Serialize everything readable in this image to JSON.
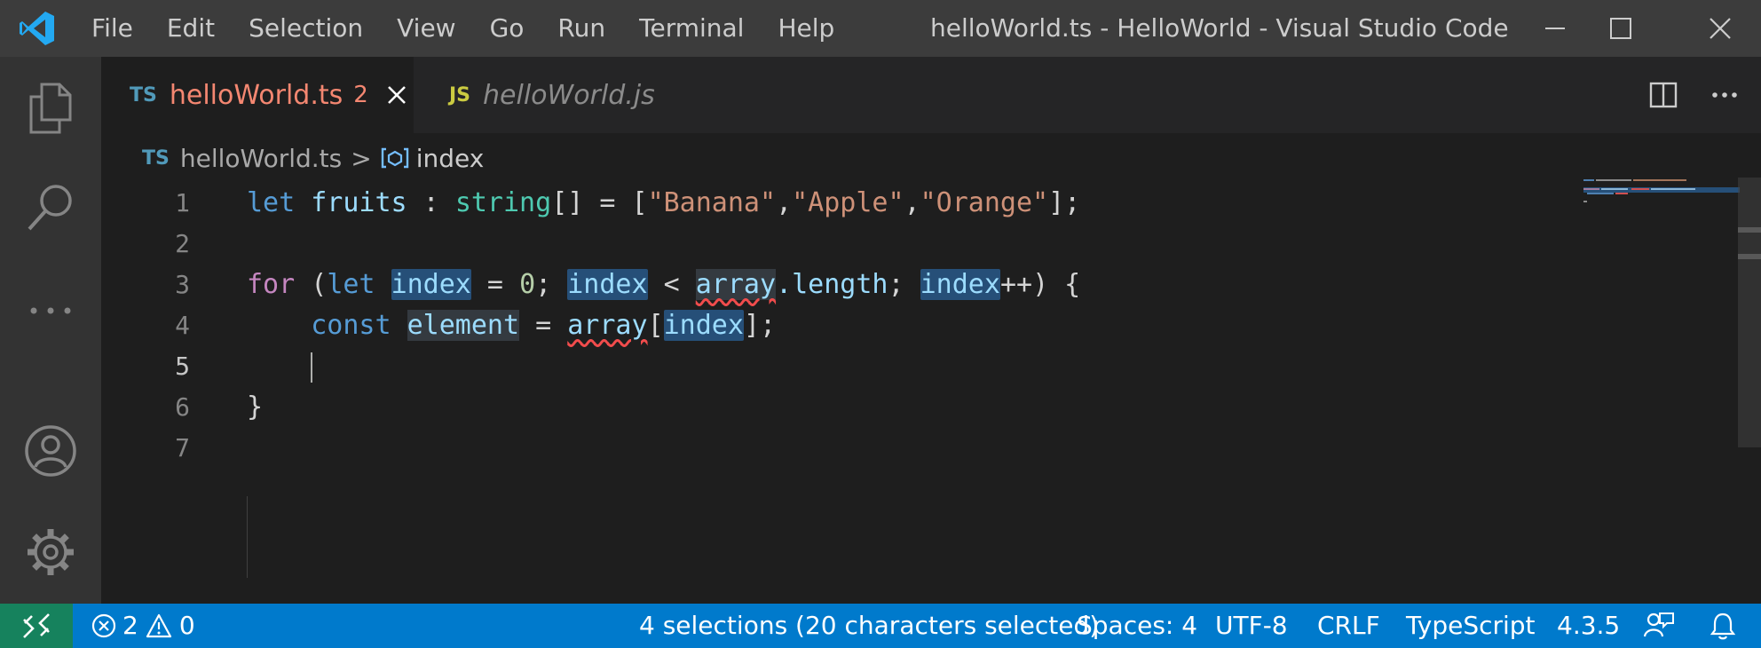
{
  "titlebar": {
    "menu": [
      "File",
      "Edit",
      "Selection",
      "View",
      "Go",
      "Run",
      "Terminal",
      "Help"
    ],
    "window_title": "helloWorld.ts - HelloWorld - Visual Studio Code",
    "icons": [
      "vscode-logo-icon",
      "minimize-icon",
      "maximize-icon",
      "close-icon"
    ]
  },
  "activity_bar": {
    "items": [
      "explorer-icon",
      "search-icon",
      "more-icon",
      "accounts-icon",
      "settings-gear-icon"
    ]
  },
  "tabs": [
    {
      "lang": "TS",
      "title": "helloWorld.ts",
      "badge": "2",
      "active": true,
      "lang_color": "#519aba",
      "title_color": "#f48771"
    },
    {
      "lang": "JS",
      "title": "helloWorld.js",
      "active": false,
      "lang_color": "#cbcb41"
    }
  ],
  "breadcrumb": {
    "lang": "TS",
    "file": "helloWorld.ts",
    "separator": ">",
    "symbol": "index"
  },
  "editor": {
    "line_numbers": [
      "1",
      "2",
      "3",
      "4",
      "5",
      "6",
      "7"
    ],
    "current_line": "5",
    "tokens": {
      "let": "let",
      "fruits": "fruits",
      "colon": " : ",
      "string": "string",
      "arr_eq": "[] = [",
      "banana": "\"Banana\"",
      "comma": ",",
      "apple": "\"Apple\"",
      "orange": "\"Orange\"",
      "close1": "];",
      "for": "for",
      "lparen": " (",
      "let2": "let",
      "sp": " ",
      "index": "index",
      "eq0a": " = ",
      "zero": "0",
      "semi": "; ",
      "lt": " < ",
      "array": "array",
      "length": ".length",
      "plusplus": "++",
      "close3": ") {",
      "indent": "    ",
      "const": "const",
      "element": "element",
      "eq": " = ",
      "lbr": "[",
      "close4": "];",
      "rbrace": "}"
    }
  },
  "status_bar": {
    "errors": "2",
    "warnings": "0",
    "selection": "4 selections (20 characters selected)",
    "spaces": "Spaces: 4",
    "encoding": "UTF-8",
    "eol": "CRLF",
    "language": "TypeScript",
    "version": "4.3.5",
    "colors": {
      "background": "#007acc",
      "remote": "#16825d"
    }
  }
}
